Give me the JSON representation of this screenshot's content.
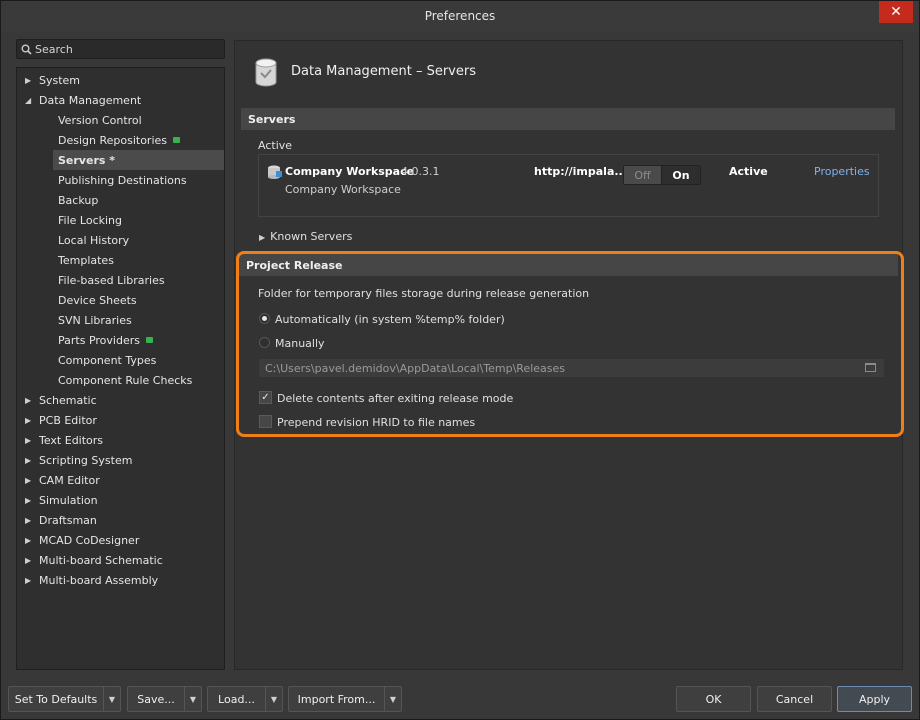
{
  "window": {
    "title": "Preferences",
    "close_glyph": "✕"
  },
  "search": {
    "placeholder": "Search",
    "icon": "search-icon"
  },
  "tree": {
    "top": [
      {
        "label": "System",
        "expanded": false
      },
      {
        "label": "Data Management",
        "expanded": true
      }
    ],
    "data_management_children": [
      {
        "label": "Version Control",
        "badge": false
      },
      {
        "label": "Design Repositories",
        "badge": true
      },
      {
        "label": "Servers *",
        "selected": true
      },
      {
        "label": "Publishing Destinations"
      },
      {
        "label": "Backup"
      },
      {
        "label": "File Locking"
      },
      {
        "label": "Local History"
      },
      {
        "label": "Templates"
      },
      {
        "label": "File-based Libraries"
      },
      {
        "label": "Device Sheets"
      },
      {
        "label": "SVN Libraries"
      },
      {
        "label": "Parts Providers",
        "badge": true
      },
      {
        "label": "Component Types"
      },
      {
        "label": "Component Rule Checks"
      }
    ],
    "bottom": [
      "Schematic",
      "PCB Editor",
      "Text Editors",
      "Scripting System",
      "CAM Editor",
      "Simulation",
      "Draftsman",
      "MCAD CoDesigner",
      "Multi-board Schematic",
      "Multi-board Assembly"
    ]
  },
  "page": {
    "title": "Data Management – Servers"
  },
  "servers": {
    "section_title": "Servers",
    "active_label": "Active",
    "workspace_name": "Company Workspace",
    "workspace_version": "4.0.3.1",
    "workspace_sub": "Company Workspace",
    "url": "http://impala...",
    "toggle_off": "Off",
    "toggle_on": "On",
    "status": "Active",
    "properties_link": "Properties",
    "known_servers": "Known Servers"
  },
  "project_release": {
    "section_title": "Project Release",
    "folder_desc": "Folder for temporary files storage during release generation",
    "option_auto": "Automatically (in system %temp% folder)",
    "option_manual": "Manually",
    "selected_option": "auto",
    "path": "C:\\Users\\pavel.demidov\\AppData\\Local\\Temp\\Releases",
    "delete_contents_label": "Delete contents after exiting release mode",
    "delete_contents_checked": true,
    "prepend_label": "Prepend revision HRID to file names",
    "prepend_checked": false
  },
  "footer": {
    "set_defaults": "Set To Defaults",
    "save": "Save...",
    "load": "Load...",
    "import": "Import From...",
    "ok": "OK",
    "cancel": "Cancel",
    "apply": "Apply"
  },
  "colors": {
    "highlight": "#f07f18",
    "link": "#7fb2ef",
    "close": "#c42b1c",
    "badge": "#37b24d"
  }
}
